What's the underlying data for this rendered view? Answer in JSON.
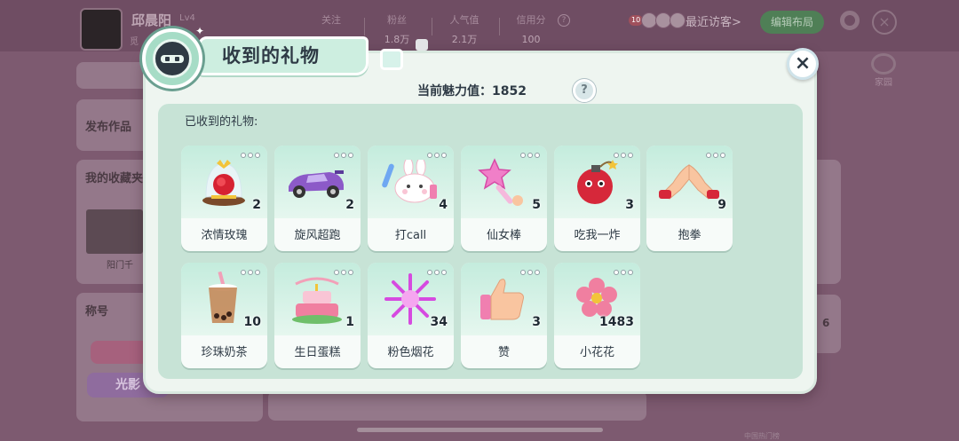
{
  "background": {
    "profile": {
      "name": "邱晨阳",
      "level": "Lv4",
      "sub_prefix": "觅"
    },
    "stats": [
      {
        "label": "关注",
        "value": ""
      },
      {
        "label": "粉丝",
        "value": "1.8万"
      },
      {
        "label": "人气值",
        "value": "2.1万"
      },
      {
        "label": "信用分",
        "value": "100"
      }
    ],
    "visitor_badge": "10",
    "recent_visitors_label": "最近访客>",
    "edit_layout_label": "编辑布局",
    "home_label": "家园",
    "publish_label": "发布作品",
    "collection_label": "我的收藏夹",
    "title_label": "称号",
    "thumb_caption": "阳门千",
    "badge_art_text": "光影",
    "side_count": "6",
    "footnote": "中国热门榜"
  },
  "modal": {
    "title": "收到的礼物",
    "charm_label": "当前魅力值：1852",
    "help_symbol": "?",
    "close_symbol": "×",
    "received_label": "已收到的礼物:"
  },
  "gifts": [
    {
      "name": "浓情玫瑰",
      "count": "2",
      "icon": "rose-dome-icon"
    },
    {
      "name": "旋风超跑",
      "count": "2",
      "icon": "race-car-icon"
    },
    {
      "name": "打call",
      "count": "4",
      "icon": "bunny-lightstick-icon"
    },
    {
      "name": "仙女棒",
      "count": "5",
      "icon": "star-wand-icon"
    },
    {
      "name": "吃我一炸",
      "count": "3",
      "icon": "bomb-icon"
    },
    {
      "name": "抱拳",
      "count": "9",
      "icon": "fist-salute-icon"
    },
    {
      "name": "珍珠奶茶",
      "count": "10",
      "icon": "bubble-tea-icon"
    },
    {
      "name": "生日蛋糕",
      "count": "1",
      "icon": "birthday-cake-icon"
    },
    {
      "name": "粉色烟花",
      "count": "34",
      "icon": "pink-firework-icon"
    },
    {
      "name": "赞",
      "count": "3",
      "icon": "thumbs-up-icon"
    },
    {
      "name": "小花花",
      "count": "1483",
      "icon": "pink-flower-icon"
    }
  ]
}
